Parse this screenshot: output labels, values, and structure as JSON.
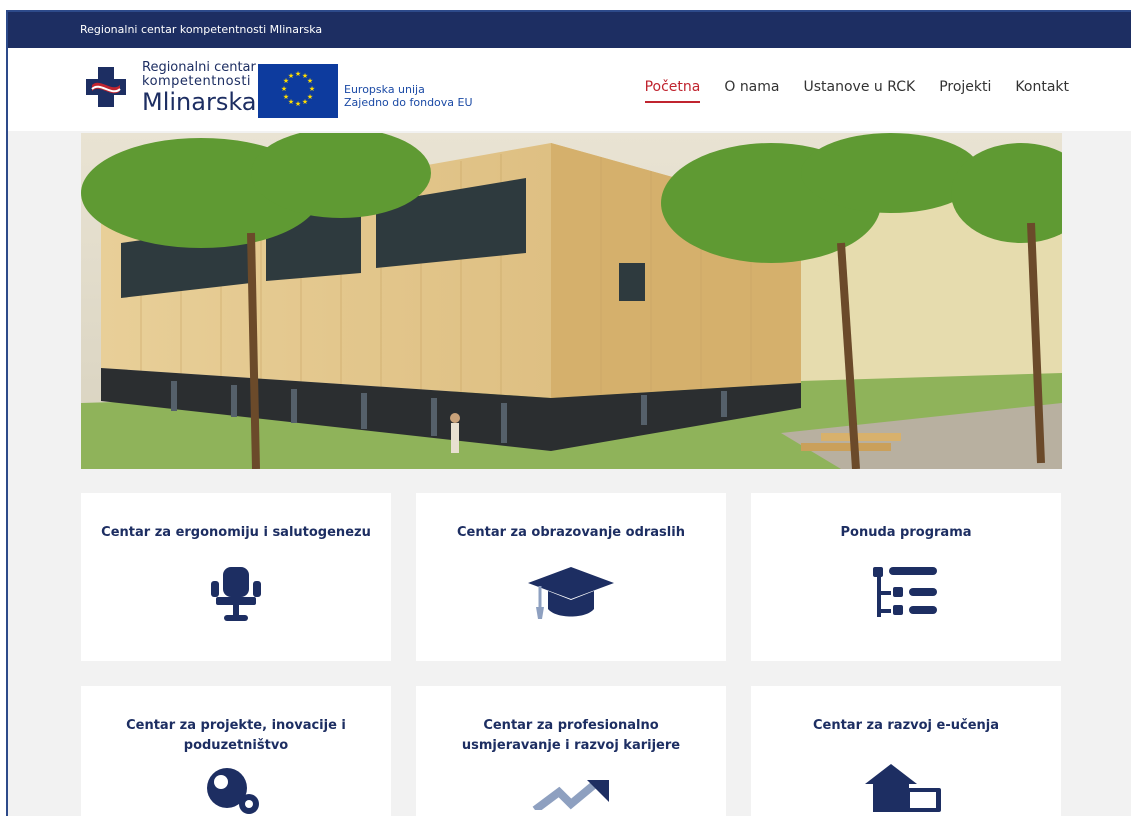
{
  "topbar": {
    "text": "Regionalni centar kompetentnosti Mlinarska"
  },
  "logo": {
    "line1": "Regionalni centar",
    "line2": "kompetentnosti",
    "line3": "Mlinarska"
  },
  "eu": {
    "line1": "Europska unija",
    "line2": "Zajedno do fondova EU"
  },
  "nav": {
    "items": [
      {
        "label": "Početna",
        "active": true
      },
      {
        "label": "O nama"
      },
      {
        "label": "Ustanove u RCK"
      },
      {
        "label": "Projekti"
      },
      {
        "label": "Kontakt"
      }
    ]
  },
  "cards": [
    {
      "title": "Centar za ergonomiju i salutogenezu",
      "icon": "office-chair-icon"
    },
    {
      "title": "Centar za obrazovanje odraslih",
      "icon": "graduation-cap-icon"
    },
    {
      "title": "Ponuda programa",
      "icon": "list-tree-icon"
    },
    {
      "title": "Centar za projekte, inovacije i poduzetništvo",
      "icon": "lightbulb-gear-icon"
    },
    {
      "title": "Centar za profesionalno usmjeravanje i razvoj karijere",
      "icon": "trend-arrow-icon"
    },
    {
      "title": "Centar za razvoj e-učenja",
      "icon": "house-laptop-icon"
    }
  ],
  "colors": {
    "navy": "#1d2e62",
    "accent_red": "#c0242f",
    "eu_blue": "#0d3b9e"
  }
}
